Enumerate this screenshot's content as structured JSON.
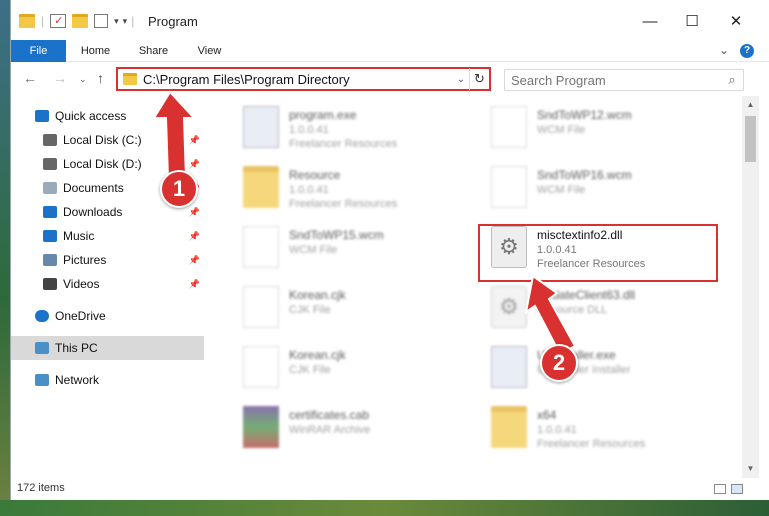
{
  "window": {
    "title": "Program",
    "controls": {
      "minimize": "—",
      "maximize": "☐",
      "close": "✕"
    }
  },
  "ribbon": {
    "tabs": [
      "File",
      "Home",
      "Share",
      "View"
    ],
    "expand": "⌄",
    "help": "?"
  },
  "address": {
    "path": "C:\\Program Files\\Program Directory",
    "search_placeholder": "Search Program"
  },
  "nav": {
    "items": [
      {
        "label": "Quick access",
        "icon": "star-icon",
        "pinned": false
      },
      {
        "label": "Local Disk (C:)",
        "icon": "drive-icon",
        "pinned": true
      },
      {
        "label": "Local Disk (D:)",
        "icon": "drive-icon",
        "pinned": true
      },
      {
        "label": "Documents",
        "icon": "documents-icon",
        "pinned": true
      },
      {
        "label": "Downloads",
        "icon": "download-icon",
        "pinned": true
      },
      {
        "label": "Music",
        "icon": "music-icon",
        "pinned": true
      },
      {
        "label": "Pictures",
        "icon": "pictures-icon",
        "pinned": true
      },
      {
        "label": "Videos",
        "icon": "videos-icon",
        "pinned": true
      },
      {
        "label": "OneDrive",
        "icon": "cloud-icon",
        "pinned": false
      },
      {
        "label": "This PC",
        "icon": "computer-icon",
        "pinned": false
      },
      {
        "label": "Network",
        "icon": "network-icon",
        "pinned": false
      }
    ]
  },
  "files": [
    {
      "name": "program.exe",
      "line2": "1.0.0.41",
      "line3": "Freelancer Resources",
      "kind": "exe"
    },
    {
      "name": "SndToWP12.wcm",
      "line2": "WCM File",
      "line3": "",
      "kind": "doc"
    },
    {
      "name": "Resource",
      "line2": "1.0.0.41",
      "line3": "Freelancer Resources",
      "kind": "folder"
    },
    {
      "name": "SndToWP16.wcm",
      "line2": "WCM File",
      "line3": "",
      "kind": "doc"
    },
    {
      "name": "SndToWP15.wcm",
      "line2": "WCM File",
      "line3": "",
      "kind": "doc"
    },
    {
      "name": "misctextinfo2.dll",
      "line2": "1.0.0.41",
      "line3": "Freelancer Resources",
      "kind": "dll"
    },
    {
      "name": "Korean.cjk",
      "line2": "CJK File",
      "line3": "",
      "kind": "doc"
    },
    {
      "name": "UpdateClient63.dll",
      "line2": "Resource DLL",
      "line3": "",
      "kind": "dll"
    },
    {
      "name": "Korean.cjk",
      "line2": "CJK File",
      "line3": "",
      "kind": "doc"
    },
    {
      "name": "Uninstaller.exe",
      "line2": "Uninstaller Installer",
      "line3": "",
      "kind": "exe"
    },
    {
      "name": "certificates.cab",
      "line2": "WinRAR Archive",
      "line3": "",
      "kind": "archive"
    },
    {
      "name": "x64",
      "line2": "1.0.0.41",
      "line3": "Freelancer Resources",
      "kind": "folder"
    }
  ],
  "status": {
    "count": "172 items"
  },
  "annotations": {
    "step1": "1",
    "step2": "2"
  },
  "colors": {
    "accent": "#1a73c9",
    "highlight": "#d9312f"
  }
}
